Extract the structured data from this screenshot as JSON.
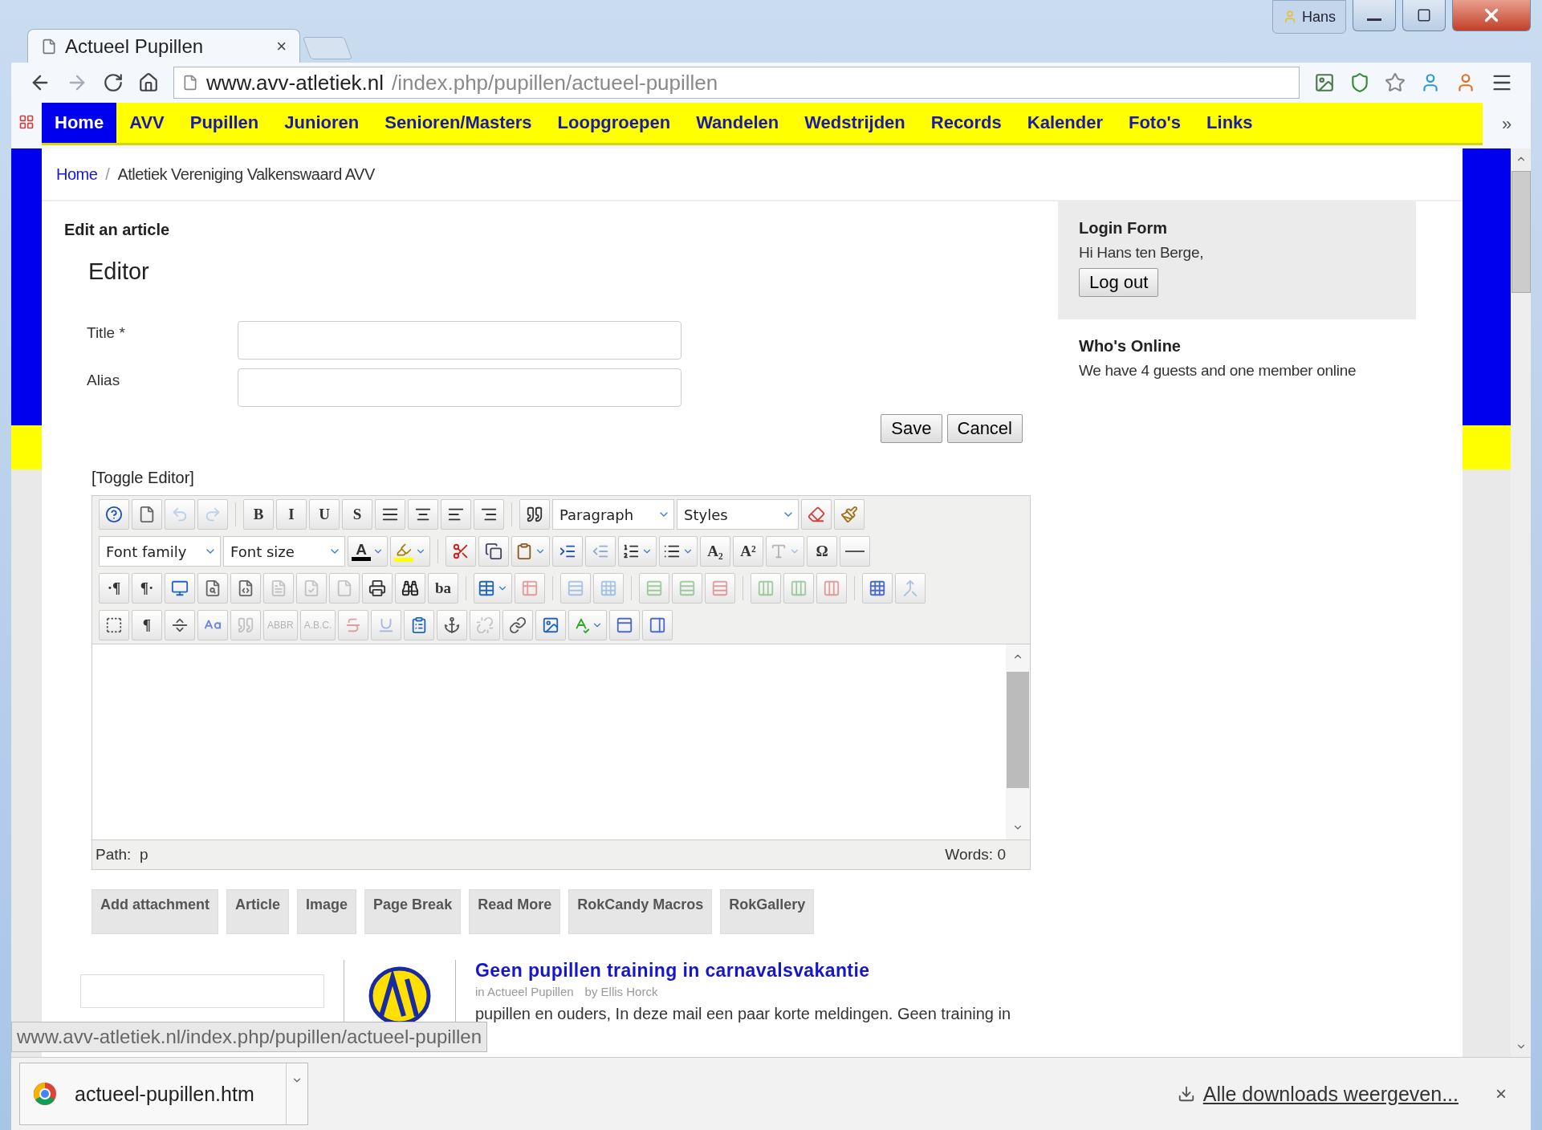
{
  "browser": {
    "tab_title": "Actueel Pupillen",
    "tab_close": "×",
    "profile": "Hans",
    "url_domain": "www.avv-atletiek.nl",
    "url_path": "/index.php/pupillen/actueel-pupillen",
    "overflow": "»"
  },
  "nav": [
    {
      "label": "Home",
      "selected": true
    },
    {
      "label": "AVV",
      "selected": false
    },
    {
      "label": "Pupillen",
      "selected": false
    },
    {
      "label": "Junioren",
      "selected": false
    },
    {
      "label": "Senioren/Masters",
      "selected": false
    },
    {
      "label": "Loopgroepen",
      "selected": false
    },
    {
      "label": "Wandelen",
      "selected": false
    },
    {
      "label": "Wedstrijden",
      "selected": false
    },
    {
      "label": "Records",
      "selected": false
    },
    {
      "label": "Kalender",
      "selected": false
    },
    {
      "label": "Foto's",
      "selected": false
    },
    {
      "label": "Links",
      "selected": false
    }
  ],
  "breadcrumb": [
    {
      "kind": "link",
      "label": "Home"
    },
    {
      "kind": "separator",
      "label": "/"
    },
    {
      "kind": "current",
      "label": "Atletiek Vereniging Valkenswaard AVV"
    }
  ],
  "page_heading": "Edit an article",
  "section_title": "Editor",
  "fields": [
    {
      "label": "Title *"
    },
    {
      "label": "Alias"
    }
  ],
  "actions": [
    "Save",
    "Cancel"
  ],
  "toggle_editor": "[Toggle Editor]",
  "toolbar": [
    [
      {
        "kind": "icon",
        "disabled": false
      },
      {
        "kind": "icon",
        "disabled": false
      },
      {
        "kind": "icon",
        "disabled": true
      },
      {
        "kind": "icon",
        "disabled": true
      },
      {
        "kind": "sep"
      },
      {
        "kind": "glyph",
        "label": "B",
        "disabled": false
      },
      {
        "kind": "glyph",
        "label": "I",
        "disabled": false
      },
      {
        "kind": "glyph",
        "label": "U",
        "disabled": false
      },
      {
        "kind": "glyph",
        "label": "S",
        "disabled": false
      },
      {
        "kind": "icon",
        "disabled": false
      },
      {
        "kind": "icon",
        "disabled": false
      },
      {
        "kind": "icon",
        "disabled": false
      },
      {
        "kind": "icon",
        "disabled": false
      },
      {
        "kind": "sep"
      },
      {
        "kind": "icon",
        "disabled": false
      },
      {
        "kind": "select",
        "label": "Paragraph"
      },
      {
        "kind": "select",
        "label": "Styles"
      },
      {
        "kind": "icon",
        "disabled": false
      },
      {
        "kind": "icon",
        "disabled": false
      }
    ],
    [
      {
        "kind": "select",
        "label": "Font family"
      },
      {
        "kind": "select",
        "label": "Font size"
      },
      {
        "kind": "color",
        "label": "A",
        "color": "#000000"
      },
      {
        "kind": "color",
        "color": "#ffff00"
      },
      {
        "kind": "sep"
      },
      {
        "kind": "icon",
        "disabled": false
      },
      {
        "kind": "icon",
        "disabled": false
      },
      {
        "kind": "icon",
        "disabled": false,
        "split": true
      },
      {
        "kind": "icon",
        "disabled": false
      },
      {
        "kind": "icon",
        "disabled": true
      },
      {
        "kind": "icon",
        "disabled": false,
        "split": true
      },
      {
        "kind": "icon",
        "disabled": false,
        "split": true
      },
      {
        "kind": "glyph",
        "label": "A₂",
        "disabled": false
      },
      {
        "kind": "glyph",
        "label": "A²",
        "disabled": false
      },
      {
        "kind": "icon",
        "disabled": true,
        "split": true
      },
      {
        "kind": "glyph",
        "label": "Ω",
        "disabled": false
      },
      {
        "kind": "icon",
        "disabled": false
      }
    ],
    [
      {
        "kind": "glyph",
        "label": "·¶",
        "disabled": false
      },
      {
        "kind": "glyph",
        "label": "¶·",
        "disabled": false
      },
      {
        "kind": "icon",
        "disabled": false
      },
      {
        "kind": "icon",
        "disabled": false
      },
      {
        "kind": "icon",
        "disabled": false
      },
      {
        "kind": "icon",
        "disabled": true
      },
      {
        "kind": "icon",
        "disabled": true
      },
      {
        "kind": "icon",
        "disabled": true
      },
      {
        "kind": "icon",
        "disabled": false
      },
      {
        "kind": "icon",
        "disabled": false
      },
      {
        "kind": "glyph",
        "label": "ba",
        "disabled": false
      },
      {
        "kind": "sep"
      },
      {
        "kind": "icon",
        "disabled": false,
        "split": true
      },
      {
        "kind": "icon",
        "disabled": true
      },
      {
        "kind": "sep"
      },
      {
        "kind": "icon",
        "disabled": true
      },
      {
        "kind": "icon",
        "disabled": true
      },
      {
        "kind": "sep"
      },
      {
        "kind": "icon",
        "disabled": true
      },
      {
        "kind": "icon",
        "disabled": true
      },
      {
        "kind": "icon",
        "disabled": true
      },
      {
        "kind": "sep"
      },
      {
        "kind": "icon",
        "disabled": true
      },
      {
        "kind": "icon",
        "disabled": true
      },
      {
        "kind": "icon",
        "disabled": true
      },
      {
        "kind": "sep"
      },
      {
        "kind": "icon",
        "disabled": false
      },
      {
        "kind": "icon",
        "disabled": true
      }
    ],
    [
      {
        "kind": "icon",
        "disabled": false
      },
      {
        "kind": "glyph",
        "label": "¶",
        "disabled": false
      },
      {
        "kind": "icon",
        "disabled": false
      },
      {
        "kind": "icon",
        "disabled": false
      },
      {
        "kind": "icon",
        "disabled": true
      },
      {
        "kind": "glyph",
        "label": "ABBR",
        "disabled": true
      },
      {
        "kind": "glyph",
        "label": "A.B.C.",
        "disabled": true
      },
      {
        "kind": "icon",
        "disabled": true
      },
      {
        "kind": "icon",
        "disabled": true
      },
      {
        "kind": "icon",
        "disabled": false
      },
      {
        "kind": "icon",
        "disabled": false
      },
      {
        "kind": "icon",
        "disabled": true
      },
      {
        "kind": "icon",
        "disabled": false
      },
      {
        "kind": "icon",
        "disabled": false
      },
      {
        "kind": "icon",
        "disabled": false,
        "split": true
      },
      {
        "kind": "icon",
        "disabled": false
      },
      {
        "kind": "icon",
        "disabled": false
      }
    ]
  ],
  "editor_status": {
    "path_label": "Path:",
    "path": "p",
    "words": "Words: 0"
  },
  "editor_buttons": [
    "Add attachment",
    "Article",
    "Image",
    "Page Break",
    "Read More",
    "RokCandy Macros",
    "RokGallery"
  ],
  "article": {
    "title": "Geen pupillen training in carnavalsvakantie",
    "category": "in Actueel Pupillen",
    "author": "by Ellis Horck",
    "excerpt": "pupillen en ouders, In deze mail een paar korte meldingen. Geen training in"
  },
  "sidebar": {
    "login": {
      "title": "Login Form",
      "greeting": "Hi Hans ten Berge,",
      "button": "Log out"
    },
    "online": {
      "title": "Who's Online",
      "text": "We have 4 guests and one member online"
    }
  },
  "status_url": "www.avv-atletiek.nl/index.php/pupillen/actueel-pupillen",
  "downloads": {
    "file": "actueel-pupillen.htm",
    "show_all": "Alle downloads weergeven...",
    "close": "×"
  }
}
